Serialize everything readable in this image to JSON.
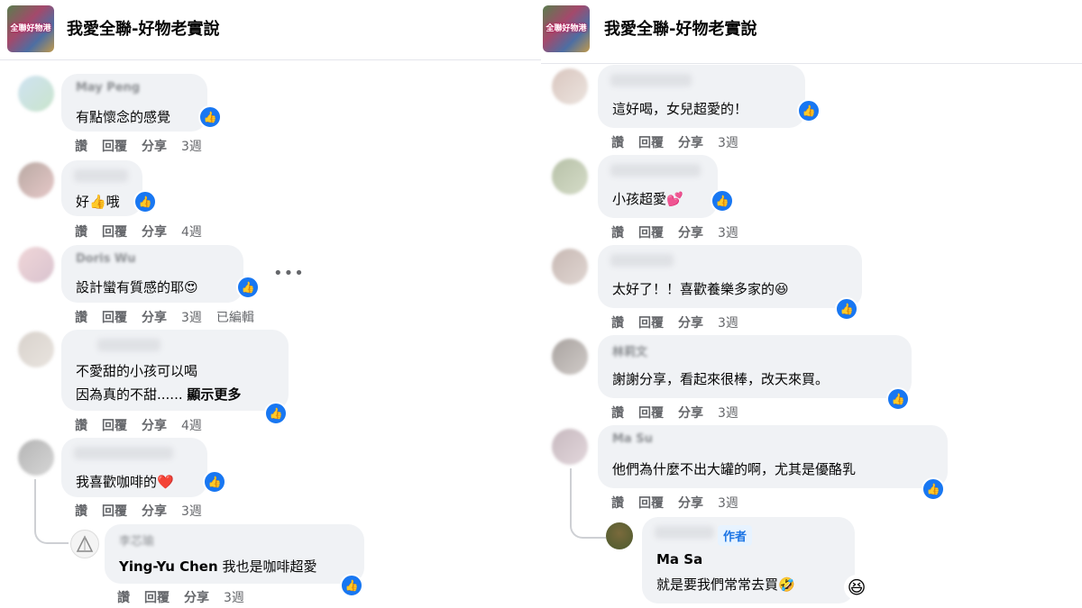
{
  "page_name": "我愛全聯-好物老實說",
  "logo_text": "全聯好物港",
  "actions": {
    "like": "讚",
    "reply": "回覆",
    "share": "分享"
  },
  "edited": "已編輯",
  "see_more": "顯示更多",
  "author_tag": "作者",
  "colors": {
    "like_blue": "#1877f2",
    "bubble": "#f0f2f5",
    "meta": "#65676b"
  },
  "left": {
    "comments": [
      {
        "name": "May Peng",
        "text": "有點懷念的感覺",
        "time": "3週"
      },
      {
        "name": "",
        "text": "好👍哦",
        "time": "4週"
      },
      {
        "name": "Doris Wu",
        "text": "設計蠻有質感的耶😍",
        "time": "3週"
      },
      {
        "name": "",
        "text_line1": "不愛甜的小孩可以喝",
        "text_line2": "因為真的不甜......",
        "time": "4週"
      },
      {
        "name": "",
        "text": "我喜歡咖啡的❤️",
        "time": "3週"
      }
    ],
    "reply": {
      "name": "李芯瑜",
      "mention": "Ying-Yu Chen",
      "text": "我也是咖啡超愛",
      "time": "3週"
    }
  },
  "right": {
    "comments": [
      {
        "name": "",
        "text": "這好喝，女兒超愛的！",
        "time": "3週"
      },
      {
        "name": "",
        "text": "小孩超愛💕",
        "time": "3週"
      },
      {
        "name": "",
        "text": "太好了！！喜歡養樂多家的😆",
        "time": "3週"
      },
      {
        "name": "林莉文",
        "text": "謝謝分享，看起來很棒，改天來買。",
        "time": "3週"
      },
      {
        "name": "Ma Su",
        "text": "他們為什麼不出大罐的啊，尤其是優酪乳",
        "time": "3週"
      }
    ],
    "reply": {
      "mention": "Ma Sa",
      "text": "就是要我們常常去買🤣",
      "reaction": "😆"
    }
  }
}
